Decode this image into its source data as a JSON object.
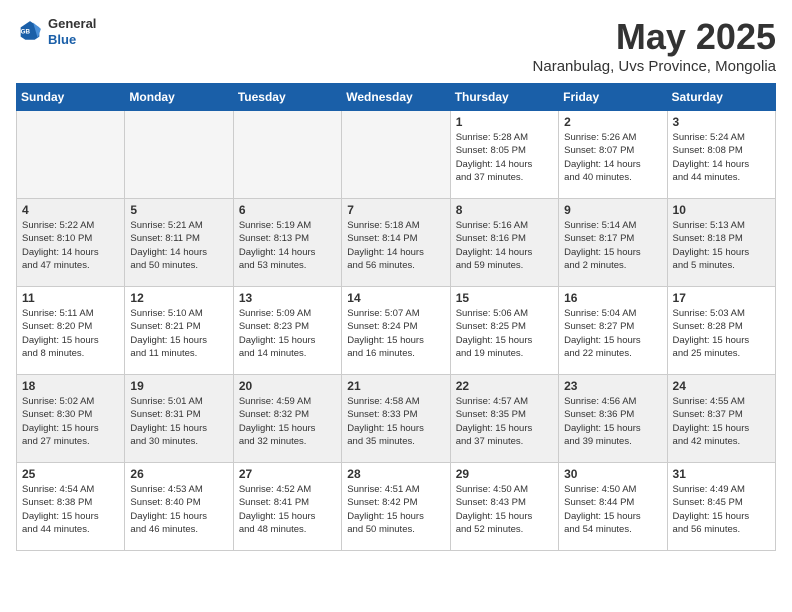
{
  "header": {
    "logo_general": "General",
    "logo_blue": "Blue",
    "title": "May 2025",
    "subtitle": "Naranbulag, Uvs Province, Mongolia"
  },
  "days_of_week": [
    "Sunday",
    "Monday",
    "Tuesday",
    "Wednesday",
    "Thursday",
    "Friday",
    "Saturday"
  ],
  "weeks": [
    {
      "days": [
        {
          "number": "",
          "info": "",
          "empty": true
        },
        {
          "number": "",
          "info": "",
          "empty": true
        },
        {
          "number": "",
          "info": "",
          "empty": true
        },
        {
          "number": "",
          "info": "",
          "empty": true
        },
        {
          "number": "1",
          "info": "Sunrise: 5:28 AM\nSunset: 8:05 PM\nDaylight: 14 hours\nand 37 minutes."
        },
        {
          "number": "2",
          "info": "Sunrise: 5:26 AM\nSunset: 8:07 PM\nDaylight: 14 hours\nand 40 minutes."
        },
        {
          "number": "3",
          "info": "Sunrise: 5:24 AM\nSunset: 8:08 PM\nDaylight: 14 hours\nand 44 minutes."
        }
      ]
    },
    {
      "days": [
        {
          "number": "4",
          "info": "Sunrise: 5:22 AM\nSunset: 8:10 PM\nDaylight: 14 hours\nand 47 minutes."
        },
        {
          "number": "5",
          "info": "Sunrise: 5:21 AM\nSunset: 8:11 PM\nDaylight: 14 hours\nand 50 minutes."
        },
        {
          "number": "6",
          "info": "Sunrise: 5:19 AM\nSunset: 8:13 PM\nDaylight: 14 hours\nand 53 minutes."
        },
        {
          "number": "7",
          "info": "Sunrise: 5:18 AM\nSunset: 8:14 PM\nDaylight: 14 hours\nand 56 minutes."
        },
        {
          "number": "8",
          "info": "Sunrise: 5:16 AM\nSunset: 8:16 PM\nDaylight: 14 hours\nand 59 minutes."
        },
        {
          "number": "9",
          "info": "Sunrise: 5:14 AM\nSunset: 8:17 PM\nDaylight: 15 hours\nand 2 minutes."
        },
        {
          "number": "10",
          "info": "Sunrise: 5:13 AM\nSunset: 8:18 PM\nDaylight: 15 hours\nand 5 minutes."
        }
      ]
    },
    {
      "days": [
        {
          "number": "11",
          "info": "Sunrise: 5:11 AM\nSunset: 8:20 PM\nDaylight: 15 hours\nand 8 minutes."
        },
        {
          "number": "12",
          "info": "Sunrise: 5:10 AM\nSunset: 8:21 PM\nDaylight: 15 hours\nand 11 minutes."
        },
        {
          "number": "13",
          "info": "Sunrise: 5:09 AM\nSunset: 8:23 PM\nDaylight: 15 hours\nand 14 minutes."
        },
        {
          "number": "14",
          "info": "Sunrise: 5:07 AM\nSunset: 8:24 PM\nDaylight: 15 hours\nand 16 minutes."
        },
        {
          "number": "15",
          "info": "Sunrise: 5:06 AM\nSunset: 8:25 PM\nDaylight: 15 hours\nand 19 minutes."
        },
        {
          "number": "16",
          "info": "Sunrise: 5:04 AM\nSunset: 8:27 PM\nDaylight: 15 hours\nand 22 minutes."
        },
        {
          "number": "17",
          "info": "Sunrise: 5:03 AM\nSunset: 8:28 PM\nDaylight: 15 hours\nand 25 minutes."
        }
      ]
    },
    {
      "days": [
        {
          "number": "18",
          "info": "Sunrise: 5:02 AM\nSunset: 8:30 PM\nDaylight: 15 hours\nand 27 minutes."
        },
        {
          "number": "19",
          "info": "Sunrise: 5:01 AM\nSunset: 8:31 PM\nDaylight: 15 hours\nand 30 minutes."
        },
        {
          "number": "20",
          "info": "Sunrise: 4:59 AM\nSunset: 8:32 PM\nDaylight: 15 hours\nand 32 minutes."
        },
        {
          "number": "21",
          "info": "Sunrise: 4:58 AM\nSunset: 8:33 PM\nDaylight: 15 hours\nand 35 minutes."
        },
        {
          "number": "22",
          "info": "Sunrise: 4:57 AM\nSunset: 8:35 PM\nDaylight: 15 hours\nand 37 minutes."
        },
        {
          "number": "23",
          "info": "Sunrise: 4:56 AM\nSunset: 8:36 PM\nDaylight: 15 hours\nand 39 minutes."
        },
        {
          "number": "24",
          "info": "Sunrise: 4:55 AM\nSunset: 8:37 PM\nDaylight: 15 hours\nand 42 minutes."
        }
      ]
    },
    {
      "days": [
        {
          "number": "25",
          "info": "Sunrise: 4:54 AM\nSunset: 8:38 PM\nDaylight: 15 hours\nand 44 minutes."
        },
        {
          "number": "26",
          "info": "Sunrise: 4:53 AM\nSunset: 8:40 PM\nDaylight: 15 hours\nand 46 minutes."
        },
        {
          "number": "27",
          "info": "Sunrise: 4:52 AM\nSunset: 8:41 PM\nDaylight: 15 hours\nand 48 minutes."
        },
        {
          "number": "28",
          "info": "Sunrise: 4:51 AM\nSunset: 8:42 PM\nDaylight: 15 hours\nand 50 minutes."
        },
        {
          "number": "29",
          "info": "Sunrise: 4:50 AM\nSunset: 8:43 PM\nDaylight: 15 hours\nand 52 minutes."
        },
        {
          "number": "30",
          "info": "Sunrise: 4:50 AM\nSunset: 8:44 PM\nDaylight: 15 hours\nand 54 minutes."
        },
        {
          "number": "31",
          "info": "Sunrise: 4:49 AM\nSunset: 8:45 PM\nDaylight: 15 hours\nand 56 minutes."
        }
      ]
    }
  ]
}
